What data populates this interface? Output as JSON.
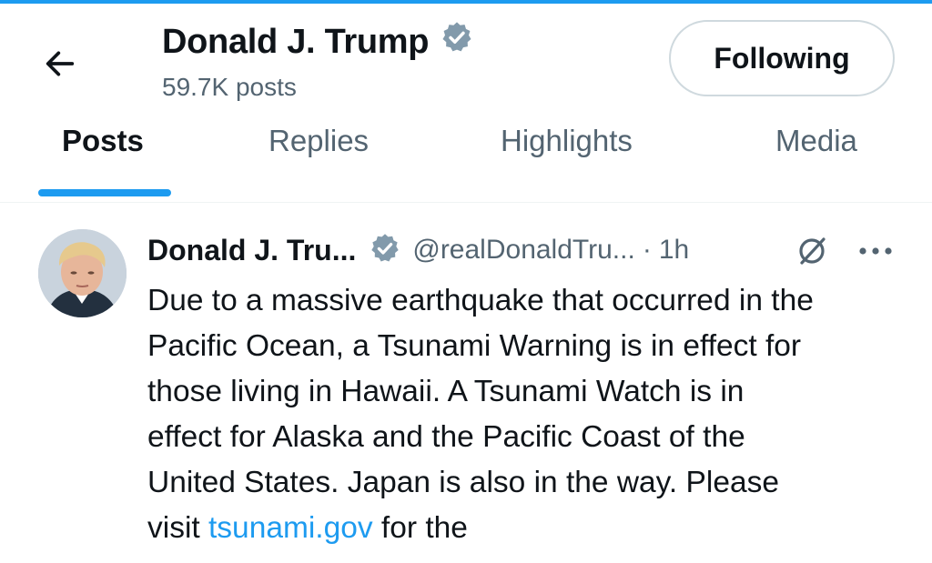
{
  "header": {
    "back_icon": "arrow-left-icon",
    "name": "Donald J. Trump",
    "verified_icon": "verified-badge-icon",
    "post_count": "59.7K posts",
    "follow_label": "Following"
  },
  "tabs": [
    {
      "label": "Posts",
      "active": true
    },
    {
      "label": "Replies",
      "active": false
    },
    {
      "label": "Highlights",
      "active": false
    },
    {
      "label": "Media",
      "active": false
    }
  ],
  "post": {
    "author_name": "Donald J. Tru...",
    "handle": "@realDonaldTru...",
    "separator": "·",
    "time": "1h",
    "grok_icon": "grok-icon",
    "more_icon": "more-horizontal-icon",
    "text_lines": [
      "Due to a massive earthquake that occurred in the",
      "Pacific Ocean, a Tsunami Warning is in effect for",
      "those living in Hawaii. A Tsunami Watch is in",
      "effect for Alaska and the Pacific Coast of the",
      "United States. Japan is also in the way. Please"
    ],
    "last_line_prefix": "visit ",
    "link_text": "tsunami.gov",
    "last_line_suffix": " for the"
  },
  "colors": {
    "accent": "#1d9bf0",
    "text_primary": "#0f1419",
    "text_secondary": "#536471",
    "verified": "#829aab"
  }
}
